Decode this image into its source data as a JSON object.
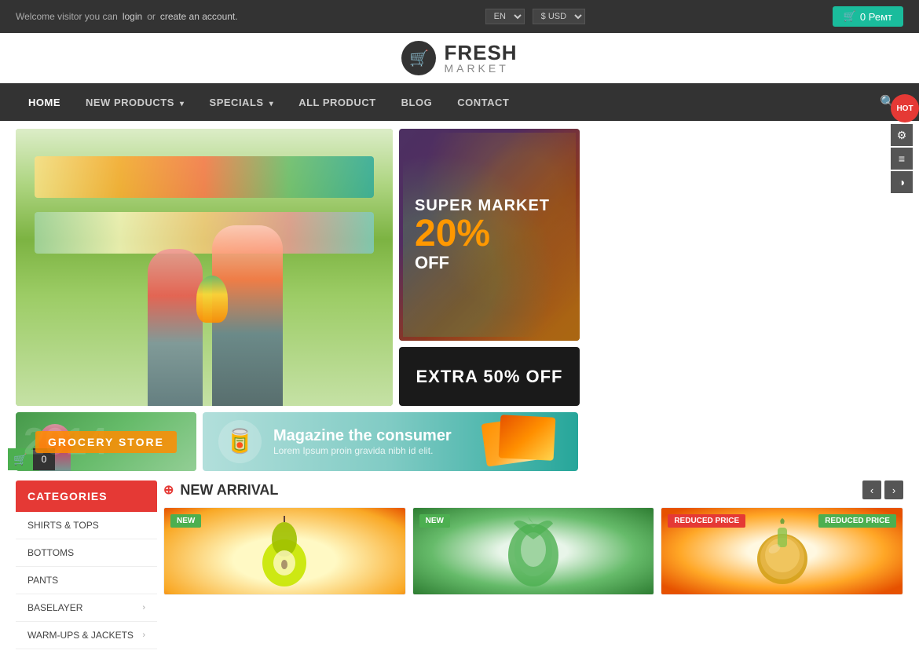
{
  "topbar": {
    "welcome": "Welcome visitor you can",
    "login": "login",
    "or": "or",
    "create_account": "create an account.",
    "cart_label": "0 Ремт",
    "lang_default": "EN",
    "currency_default": "$ USD"
  },
  "logo": {
    "fresh": "FRESH",
    "market": "MARKET",
    "icon": "🛒"
  },
  "nav": {
    "items": [
      {
        "label": "HOME",
        "active": true,
        "has_dropdown": false
      },
      {
        "label": "NEW PRODUCTS",
        "active": false,
        "has_dropdown": true
      },
      {
        "label": "SPECIALS",
        "active": false,
        "has_dropdown": true
      },
      {
        "label": "ALL PRODUCT",
        "active": false,
        "has_dropdown": false
      },
      {
        "label": "BLOG",
        "active": false,
        "has_dropdown": false
      },
      {
        "label": "CONTACT",
        "active": false,
        "has_dropdown": false
      }
    ]
  },
  "banners": {
    "super_market": "SUPER MARKET",
    "percent": "20%",
    "off": "OFF",
    "extra_off": "EXTRA 50% OFF",
    "grocery_year": "2014",
    "grocery_label": "GROCERY STORE",
    "magazine_title": "Magazine the consumer",
    "magazine_sub": "Lorem Ipsum proin gravida nibh id elit."
  },
  "categories": {
    "header": "CATEGORIES",
    "items": [
      {
        "label": "SHIRTS & TOPS",
        "has_arrow": false
      },
      {
        "label": "BOTTOMS",
        "has_arrow": false
      },
      {
        "label": "PANTS",
        "has_arrow": false
      },
      {
        "label": "BASELAYER",
        "has_arrow": true
      },
      {
        "label": "WARM-UPS & JACKETS",
        "has_arrow": true
      }
    ]
  },
  "new_arrival": {
    "title": "NEW ARRIVAL",
    "products": [
      {
        "badge": "NEW",
        "badge_type": "new",
        "name": "Pear",
        "emoji": "🍐"
      },
      {
        "badge": "NEW",
        "badge_type": "new",
        "name": "Cabbage",
        "emoji": "🥬"
      },
      {
        "badge": "REDUCED PRICE",
        "badge_type": "reduced",
        "name": "Onion",
        "emoji": "🧅"
      }
    ]
  },
  "side_panel": {
    "hot_label": "HOT",
    "gear_icon": "⚙",
    "sliders_icon": "≡",
    "contrast_icon": "◑"
  },
  "cart_float": {
    "icon": "🛒",
    "count": "0"
  }
}
